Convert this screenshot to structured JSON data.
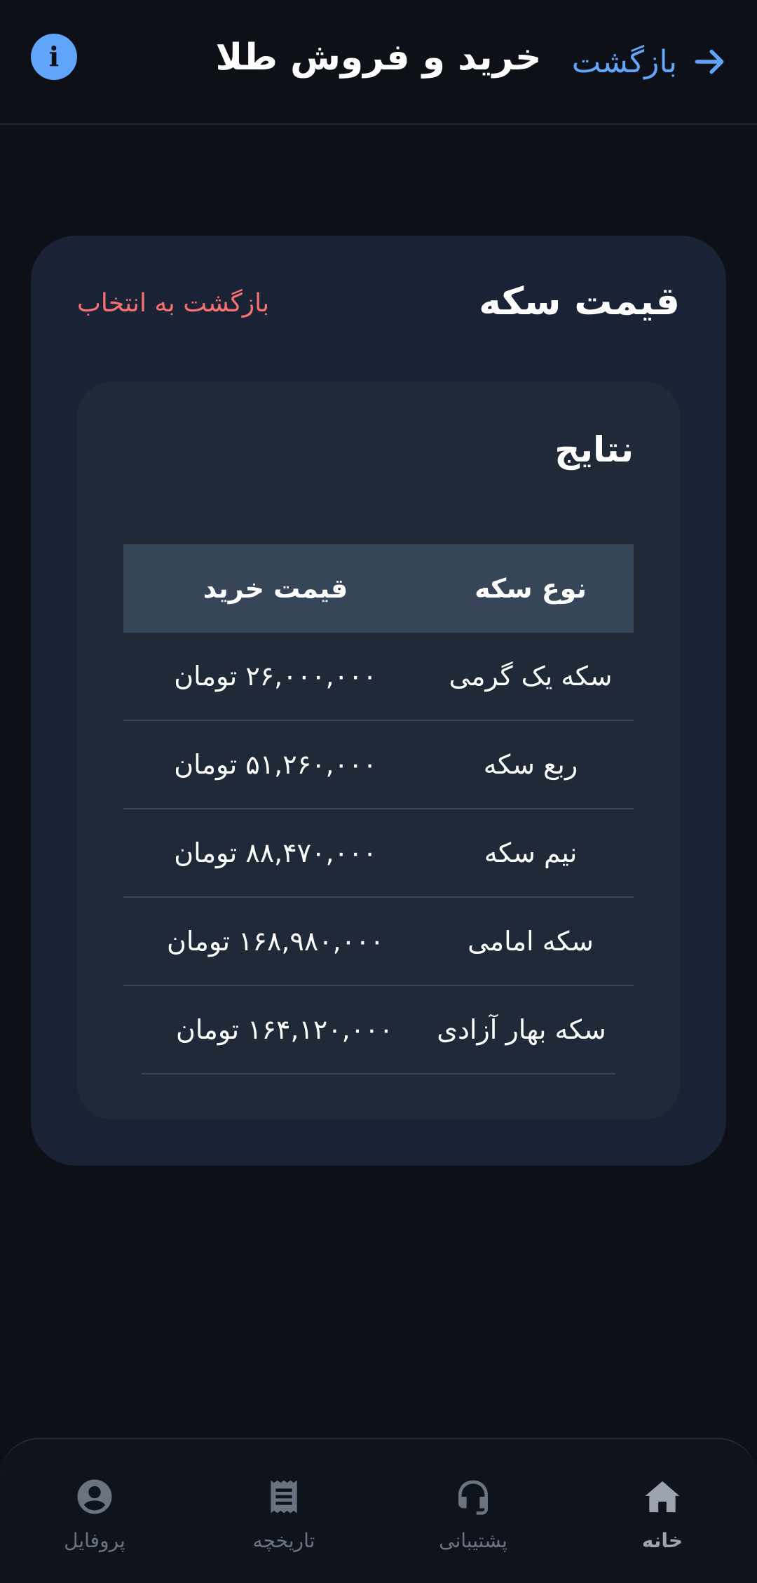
{
  "header": {
    "back_label": "بازگشت",
    "title": "خرید و فروش طلا",
    "info_icon": "i"
  },
  "card": {
    "title": "قیمت سکه",
    "reset_link": "بازگشت به انتخاب"
  },
  "results": {
    "title": "نتایج",
    "columns": {
      "type": "نوع سکه",
      "price": "قیمت خرید"
    },
    "rows": [
      {
        "type": "سکه یک گرمی",
        "price": "۲۶,۰۰۰,۰۰۰ تومان"
      },
      {
        "type": "ربع سکه",
        "price": "۵۱,۲۶۰,۰۰۰ تومان"
      },
      {
        "type": "نیم سکه",
        "price": "۸۸,۴۷۰,۰۰۰ تومان"
      },
      {
        "type": "سکه امامی",
        "price": "۱۶۸,۹۸۰,۰۰۰ تومان"
      },
      {
        "type": "سکه بهار آزادی",
        "price": "۱۶۴,۱۲۰,۰۰۰ تومان"
      }
    ]
  },
  "nav": {
    "items": [
      {
        "label": "خانه",
        "icon": "home-icon",
        "active": true
      },
      {
        "label": "پشتیبانی",
        "icon": "headset-icon",
        "active": false
      },
      {
        "label": "تاریخچه",
        "icon": "receipt-icon",
        "active": false
      },
      {
        "label": "پروفایل",
        "icon": "user-icon",
        "active": false
      }
    ]
  },
  "colors": {
    "background": "#0d1017",
    "card": "#1a2236",
    "inner_card": "#1f2937",
    "table_header": "#374559",
    "accent_blue": "#60a5fa",
    "accent_red": "#f87171"
  }
}
